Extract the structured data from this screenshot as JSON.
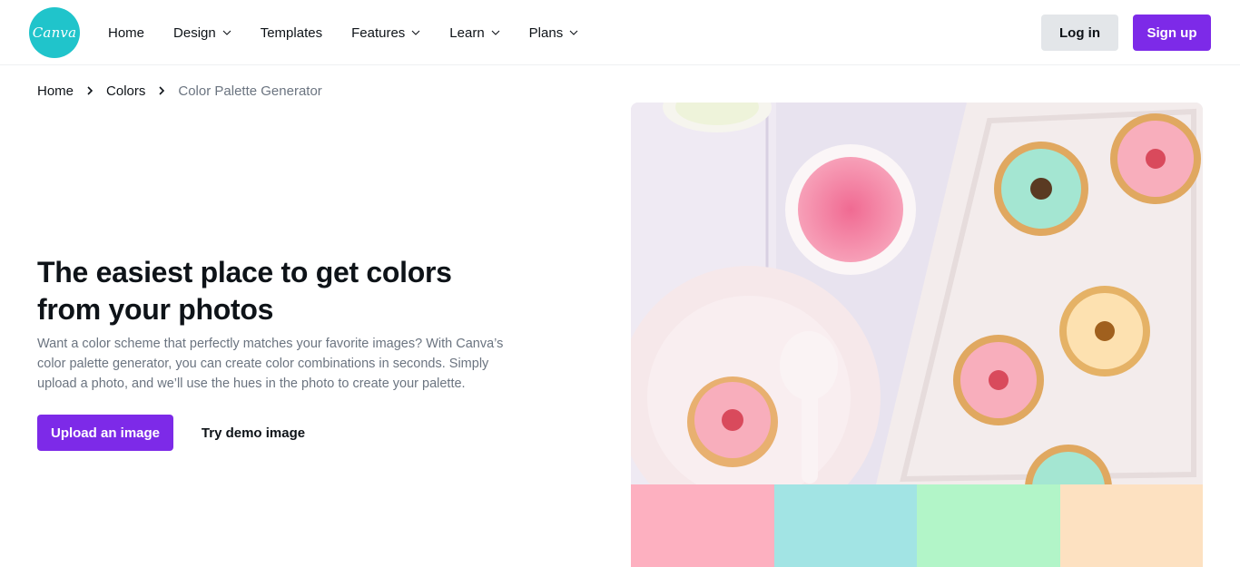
{
  "brand": {
    "logo_text": "Canva",
    "logo_color": "#20c4cb",
    "accent": "#7d2ae8"
  },
  "nav": {
    "items": [
      {
        "label": "Home",
        "has_dropdown": false
      },
      {
        "label": "Design",
        "has_dropdown": true
      },
      {
        "label": "Templates",
        "has_dropdown": false
      },
      {
        "label": "Features",
        "has_dropdown": true
      },
      {
        "label": "Learn",
        "has_dropdown": true
      },
      {
        "label": "Plans",
        "has_dropdown": true
      }
    ],
    "login_label": "Log in",
    "signup_label": "Sign up"
  },
  "breadcrumb": {
    "items": [
      "Home",
      "Colors",
      "Color Palette Generator"
    ]
  },
  "hero": {
    "title": "The easiest place to get colors from your photos",
    "description": "Want a color scheme that perfectly matches your favorite images? With Canva’s color palette generator, you can create color combinations in seconds. Simply upload a photo, and we’ll use the hues in the photo to create your palette.",
    "upload_label": "Upload an image",
    "demo_label": "Try demo image"
  },
  "palette": {
    "colors": [
      "#fdb0c0",
      "#a2e4e4",
      "#b2f5c8",
      "#fde1c1"
    ]
  },
  "icons": {
    "chevron": "chevron-down-icon",
    "breadcrumb_sep": "chevron-right-icon"
  }
}
